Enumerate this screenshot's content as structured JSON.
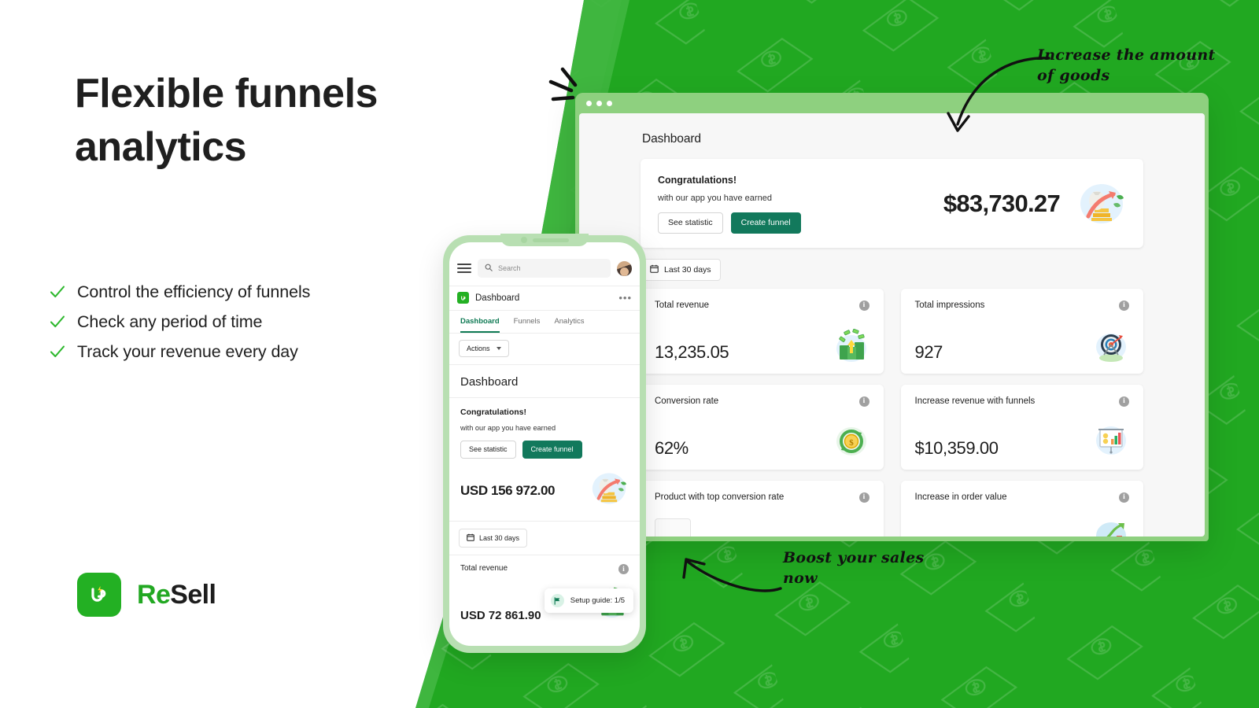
{
  "marketing": {
    "headline": "Flexible funnels analytics",
    "features": [
      "Control the efficiency of funnels",
      "Check any period of time",
      "Track your revenue every day"
    ],
    "logo": {
      "name_part1": "Re",
      "name_part2": "Sell",
      "icon": "up-arrow-logo-icon"
    }
  },
  "annotations": {
    "top": "Increase the amount of goods",
    "bottom": "Boost your sales now"
  },
  "desktop": {
    "window_title": "Dashboard",
    "congrats": {
      "title": "Congratulations!",
      "subtitle": "with our app you have earned",
      "see_statistic": "See statistic",
      "create_funnel": "Create funnel",
      "amount": "$83,730.27"
    },
    "date_filter": "Last 30 days",
    "cards": [
      {
        "label": "Total revenue",
        "value": "13,235.05",
        "icon": "money-stack-icon"
      },
      {
        "label": "Total impressions",
        "value": "927",
        "icon": "target-dartboard-icon"
      },
      {
        "label": "Conversion rate",
        "value": "62%",
        "icon": "coin-refresh-icon"
      },
      {
        "label": "Increase revenue with funnels",
        "value": "$10,359.00",
        "icon": "presentation-chart-icon"
      },
      {
        "label": "Product with top conversion rate",
        "value": "",
        "icon": "product-thumbnail-icon"
      },
      {
        "label": "Increase in order value",
        "value": "",
        "icon": "growth-arrow-chart-icon"
      }
    ]
  },
  "mobile": {
    "search_placeholder": "Search",
    "app_title": "Dashboard",
    "tabs": [
      {
        "label": "Dashboard",
        "active": true
      },
      {
        "label": "Funnels",
        "active": false
      },
      {
        "label": "Analytics",
        "active": false
      }
    ],
    "actions_label": "Actions",
    "page_title": "Dashboard",
    "congrats": {
      "title": "Congratulations!",
      "subtitle": "with our app you have earned",
      "see_statistic": "See statistic",
      "create_funnel": "Create funnel",
      "amount": "USD 156 972.00"
    },
    "date_filter": "Last 30 days",
    "stat": {
      "label": "Total revenue",
      "value": "USD 72 861.90"
    },
    "setup_guide": "Setup guide: 1/5"
  },
  "colors": {
    "brand_green": "#22a822",
    "bright_green": "#3fb63f",
    "light_green": "#8ed07f",
    "teal_button": "#12795c",
    "phone_bezel": "#b8dfb2"
  }
}
